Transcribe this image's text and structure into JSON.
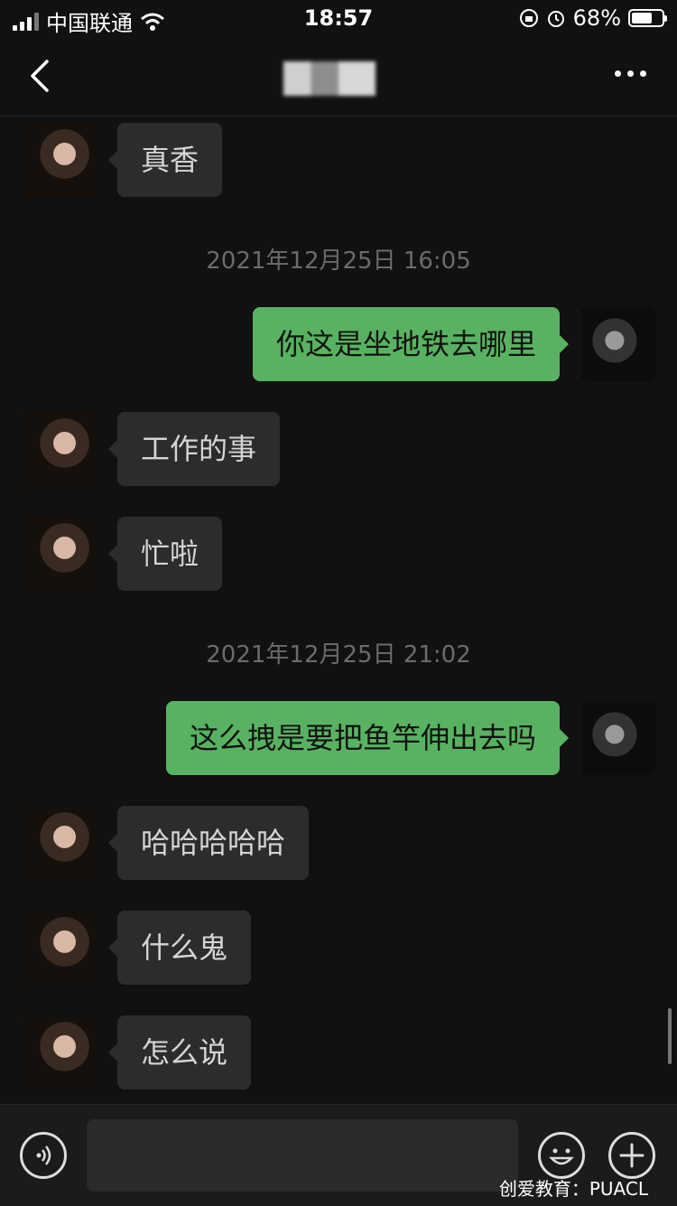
{
  "status_bar": {
    "carrier": "中国联通",
    "time": "18:57",
    "battery": "68%",
    "battery_level": 0.68
  },
  "header": {
    "title": "",
    "more_icon": "more-dots-icon",
    "back_icon": "chevron-left-icon"
  },
  "messages": [
    {
      "type": "incoming",
      "text": "真香"
    },
    {
      "type": "timestamp",
      "text": "2021年12月25日 16:05"
    },
    {
      "type": "outgoing",
      "text": "你这是坐地铁去哪里"
    },
    {
      "type": "incoming",
      "text": "工作的事"
    },
    {
      "type": "incoming",
      "text": "忙啦"
    },
    {
      "type": "timestamp",
      "text": "2021年12月25日 21:02"
    },
    {
      "type": "outgoing",
      "text": "这么拽是要把鱼竿伸出去吗"
    },
    {
      "type": "incoming",
      "text": "哈哈哈哈哈"
    },
    {
      "type": "incoming",
      "text": "什么鬼"
    },
    {
      "type": "incoming",
      "text": "怎么说"
    }
  ],
  "input_bar": {
    "input_value": "",
    "voice_icon": "voice-icon",
    "emoji_icon": "emoji-icon",
    "plus_icon": "plus-icon"
  },
  "watermark": "创爱教育：PUACL",
  "colors": {
    "background": "#111111",
    "incoming_bubble": "#2c2c2c",
    "outgoing_bubble": "#59b262",
    "timestamp_text": "#6b6b6b"
  }
}
